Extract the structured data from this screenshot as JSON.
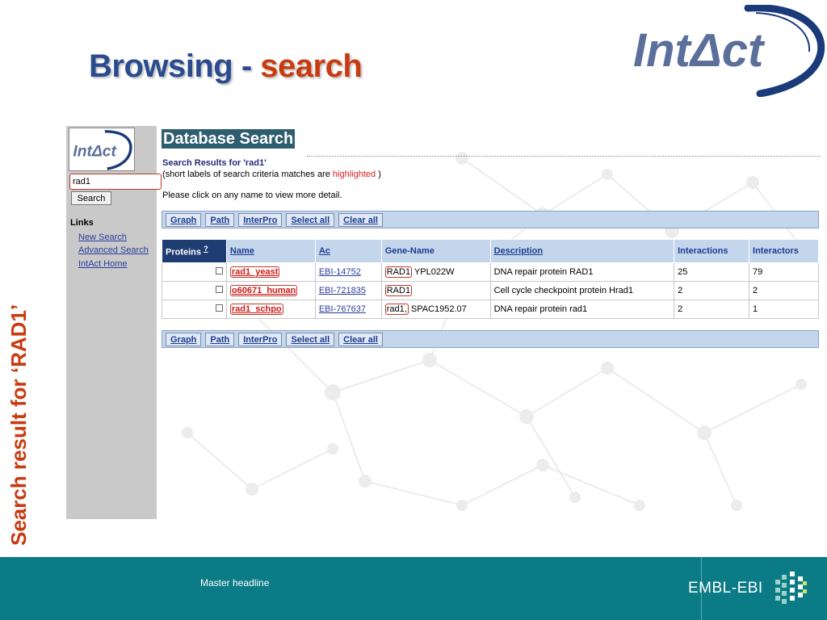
{
  "slide": {
    "title_part1": "Browsing - ",
    "title_part2": "search",
    "side_label": "Search result for ‘RAD1’",
    "logo_text": "IntΔct",
    "footer_headline": "Master headline",
    "footer_brand": "EMBL-EBI"
  },
  "app": {
    "nav_logo_text": "IntΔct",
    "search": {
      "value": "rad1",
      "button_label": "Search"
    },
    "links_heading": "Links",
    "links": [
      "New Search",
      "Advanced Search",
      "IntAct Home"
    ],
    "page_title": "Database Search",
    "results_heading": "Search Results for 'rad1'",
    "results_note_pre": "(short labels of search criteria matches are ",
    "results_note_hl": "highlighted",
    "results_note_post": " )",
    "click_note": "Please click on any name to view more detail.",
    "actions": [
      "Graph",
      "Path",
      "InterPro",
      "Select all",
      "Clear all"
    ],
    "table": {
      "columns": {
        "proteins": "Proteins",
        "help": "?",
        "name": "Name",
        "ac": "Ac",
        "gene": "Gene-Name",
        "desc": "Description",
        "interactions": "Interactions",
        "interactors": "Interactors"
      },
      "rows": [
        {
          "name": "rad1_yeast",
          "ac": "EBI-14752",
          "gene_hl": "RAD1",
          "gene_rest": "YPL022W",
          "desc": "DNA repair protein RAD1",
          "interactions": "25",
          "interactors": "79"
        },
        {
          "name": "o60671_human",
          "ac": "EBI-721835",
          "gene_hl": "RAD1",
          "gene_rest": "",
          "desc": "Cell cycle checkpoint protein Hrad1",
          "interactions": "2",
          "interactors": "2"
        },
        {
          "name": "rad1_schpo",
          "ac": "EBI-767637",
          "gene_hl": "rad1,",
          "gene_rest": "SPAC1952.07",
          "desc": "DNA repair protein rad1",
          "interactions": "2",
          "interactors": "1"
        }
      ]
    }
  },
  "colors": {
    "title_blue": "#2b4b8f",
    "title_red": "#c83a10",
    "footer_teal": "#0b7b86"
  }
}
